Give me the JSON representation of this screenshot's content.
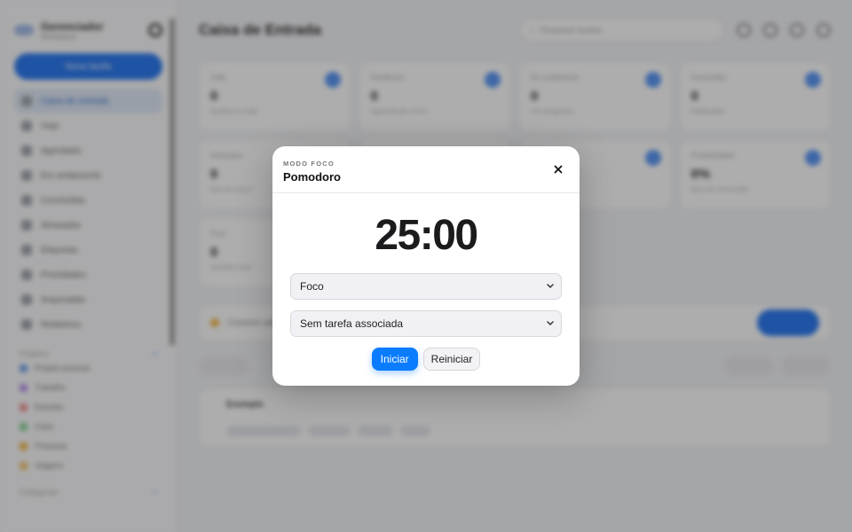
{
  "background": {
    "sidebar": {
      "brand_title": "Gerenciador",
      "brand_sub": "Workspace",
      "new_button": "Nova tarefa",
      "items": [
        {
          "label": "Caixa de entrada",
          "active": true
        },
        {
          "label": "Hoje"
        },
        {
          "label": "Agendado"
        },
        {
          "label": "Em andamento"
        },
        {
          "label": "Concluídas"
        },
        {
          "label": "Atrasadas"
        },
        {
          "label": "Etiquetas"
        },
        {
          "label": "Prioridades"
        },
        {
          "label": "Arquivadas"
        },
        {
          "label": "Relatórios"
        }
      ],
      "projects_heading": "Projetos",
      "projects": [
        {
          "label": "Projeto pessoal",
          "color": "#6a9cf0"
        },
        {
          "label": "Trabalho",
          "color": "#b78ce8"
        },
        {
          "label": "Estudos",
          "color": "#f08a8a"
        },
        {
          "label": "Casa",
          "color": "#7fd08c"
        },
        {
          "label": "Finanças",
          "color": "#f4b23c"
        },
        {
          "label": "Viagens",
          "color": "#f0c060"
        }
      ],
      "areas_heading": "Categorias"
    },
    "main": {
      "title": "Caixa de Entrada",
      "search_placeholder": "Pesquisar tarefas",
      "cards": [
        {
          "label": "Total",
          "value": "0",
          "sub": "tarefas no total"
        },
        {
          "label": "Pendentes",
          "value": "0",
          "sub": "aguardando início"
        },
        {
          "label": "Em andamento",
          "value": "0",
          "sub": "em progresso"
        },
        {
          "label": "Concluídas",
          "value": "0",
          "sub": "finalizadas"
        },
        {
          "label": "Atrasadas",
          "value": "0",
          "sub": "fora do prazo"
        },
        {
          "label": "",
          "value": "",
          "sub": ""
        },
        {
          "label": "",
          "value": "",
          "sub": ""
        },
        {
          "label": "Produtividade",
          "value": "0%",
          "sub": "taxa de conclusão"
        },
        {
          "label": "Foco",
          "value": "0",
          "sub": "sessões hoje"
        }
      ],
      "banner_text": "Comece adicionando sua primeira tarefa",
      "task_title": "Exemplo"
    }
  },
  "modal": {
    "eyebrow": "MODO FOCO",
    "title": "Pomodoro",
    "timer": "25:00",
    "mode_select": {
      "selected": "Foco"
    },
    "task_select": {
      "selected": "Sem tarefa associada"
    },
    "start_label": "Iniciar",
    "reset_label": "Reiniciar",
    "accent_color": "#0a7cff"
  }
}
